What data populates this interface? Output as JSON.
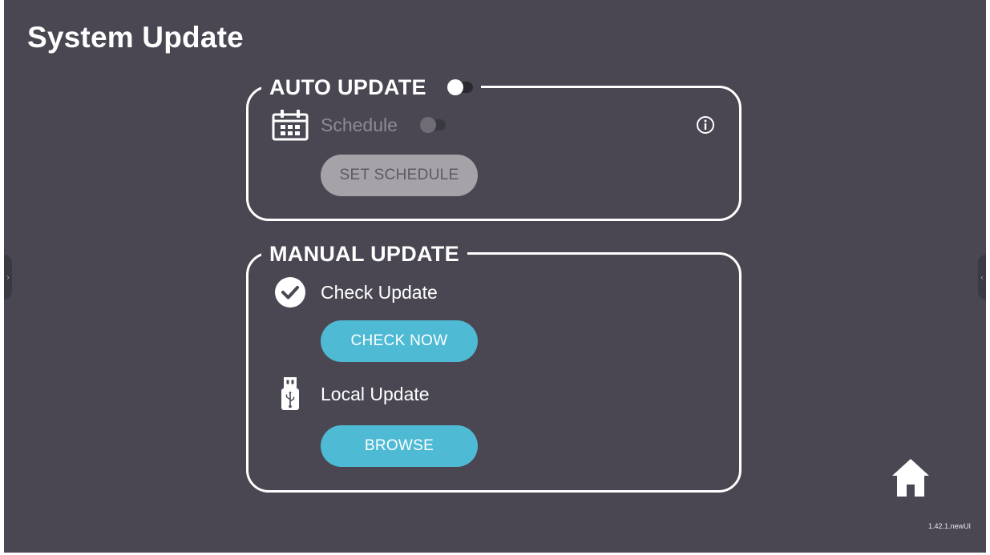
{
  "page": {
    "title": "System Update",
    "version": "1.42.1.newUI"
  },
  "auto_update": {
    "heading": "AUTO UPDATE",
    "enabled": true,
    "schedule": {
      "label": "Schedule",
      "enabled": false,
      "icon": "calendar-icon"
    },
    "info_icon": "info-icon",
    "set_schedule_button": "SET SCHEDULE"
  },
  "manual_update": {
    "heading": "MANUAL UPDATE",
    "check_update": {
      "label": "Check Update",
      "icon": "check-circle-icon",
      "button": "CHECK NOW"
    },
    "local_update": {
      "label": "Local Update",
      "icon": "usb-drive-icon",
      "button": "BROWSE"
    }
  },
  "nav": {
    "home_icon": "home-icon",
    "left_tab_glyph": "›",
    "right_tab_glyph": "‹"
  },
  "colors": {
    "background": "#4a4752",
    "accent": "#4ebad4",
    "disabled_button": "#a5a3a8",
    "text": "#ffffff"
  }
}
